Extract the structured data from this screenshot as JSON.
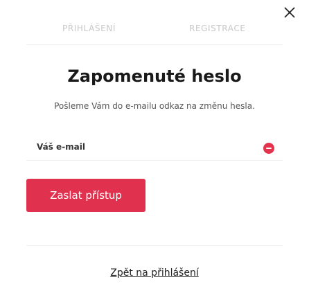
{
  "tabs": {
    "login": "Přihlášení",
    "register": "Registrace"
  },
  "title": "Zapomenuté heslo",
  "subtitle": "Pošleme Vám do e-mailu odkaz na změnu hesla.",
  "email_field": {
    "label": "Váš e-mail",
    "value": "",
    "placeholder": ""
  },
  "submit_label": "Zaslat přístup",
  "back_link": "Zpět na přihlášení",
  "colors": {
    "accent": "#e0314f",
    "error_icon": "#e3344e",
    "tab_inactive": "#c8c8c8"
  },
  "icons": {
    "close": "close-icon",
    "field_status": "error-minus-icon"
  }
}
